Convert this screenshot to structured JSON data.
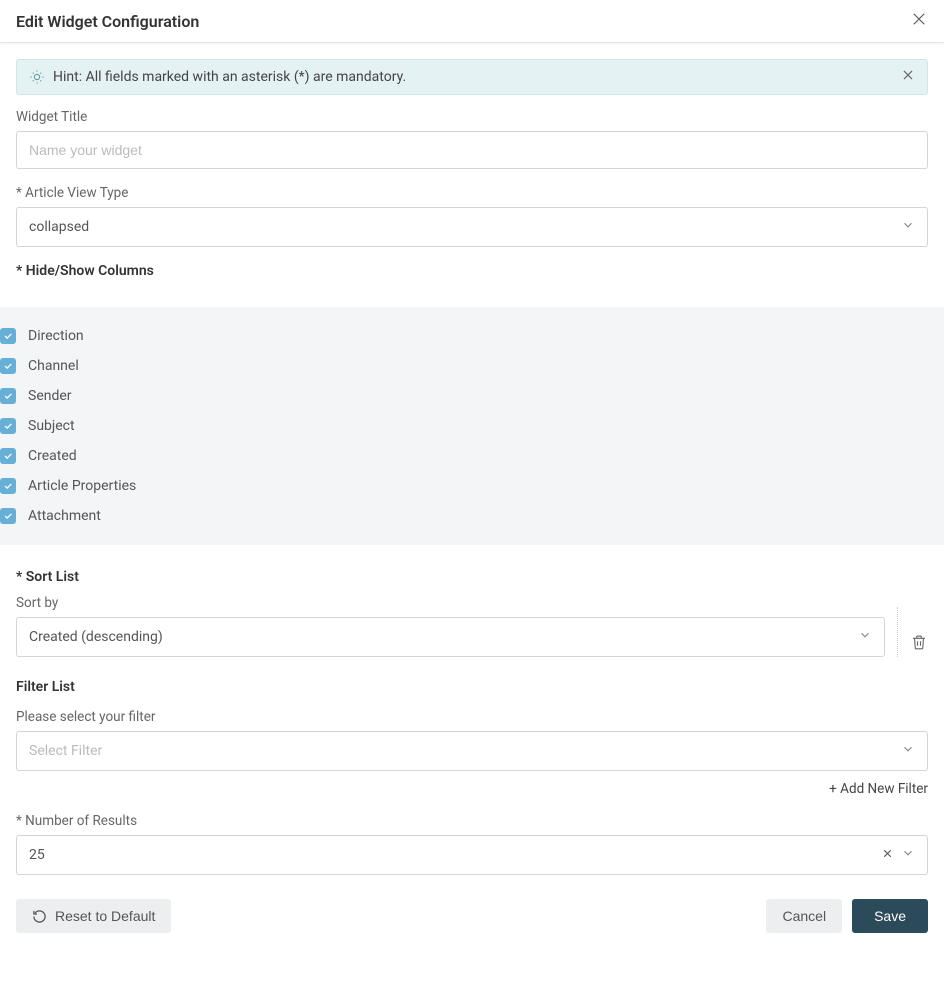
{
  "dialog": {
    "title": "Edit Widget Configuration"
  },
  "hint": {
    "text": "Hint: All fields marked with an asterisk (*) are mandatory."
  },
  "widgetTitle": {
    "label": "Widget Title",
    "placeholder": "Name your widget",
    "value": ""
  },
  "viewType": {
    "label": "* Article View Type",
    "value": "collapsed"
  },
  "columns": {
    "label": "* Hide/Show Columns",
    "items": [
      {
        "label": "Direction",
        "checked": true
      },
      {
        "label": "Channel",
        "checked": true
      },
      {
        "label": "Sender",
        "checked": true
      },
      {
        "label": "Subject",
        "checked": true
      },
      {
        "label": "Created",
        "checked": true
      },
      {
        "label": "Article Properties",
        "checked": true
      },
      {
        "label": "Attachment",
        "checked": true
      }
    ]
  },
  "sort": {
    "label": "* Sort List",
    "sublabel": "Sort by",
    "value": "Created (descending)"
  },
  "filter": {
    "label": "Filter List",
    "sublabel": "Please select your filter",
    "placeholder": "Select Filter",
    "addLink": "+ Add New Filter"
  },
  "results": {
    "label": "* Number of Results",
    "value": "25"
  },
  "buttons": {
    "reset": "Reset to Default",
    "cancel": "Cancel",
    "save": "Save"
  }
}
